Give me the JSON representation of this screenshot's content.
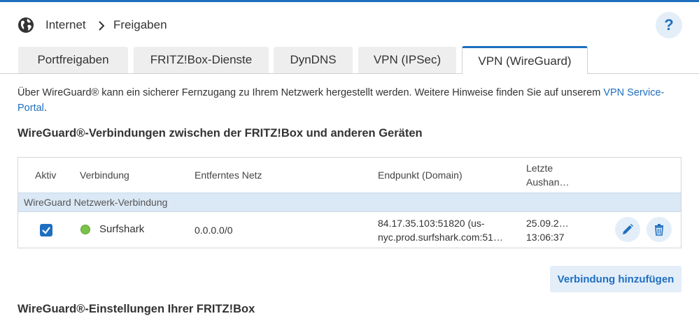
{
  "header": {
    "breadcrumb": [
      "Internet",
      "Freigaben"
    ],
    "help_label": "?"
  },
  "tabs": [
    {
      "label": "Portfreigaben",
      "active": false
    },
    {
      "label": "FRITZ!Box-Dienste",
      "active": false
    },
    {
      "label": "DynDNS",
      "active": false
    },
    {
      "label": "VPN (IPSec)",
      "active": false
    },
    {
      "label": "VPN (WireGuard)",
      "active": true
    }
  ],
  "intro": {
    "text": "Über WireGuard® kann ein sicherer Fernzugang zu Ihrem Netzwerk hergestellt werden. Weitere Hinweise finden Sie auf unserem ",
    "link": "VPN Service-Portal",
    "suffix": "."
  },
  "section_title": "WireGuard®-Verbindungen zwischen der FRITZ!Box und anderen Geräten",
  "table": {
    "headers": {
      "active": "Aktiv",
      "connection": "Verbindung",
      "remote_net": "Entferntes Netz",
      "endpoint": "Endpunkt (Domain)",
      "last_line1": "Letzte",
      "last_line2": "Aushan…"
    },
    "group_label": "WireGuard Netzwerk-Verbindung",
    "rows": [
      {
        "active": true,
        "status_color": "#7bc24a",
        "name": "Surfshark",
        "remote_net": "0.0.0.0/0",
        "endpoint_line1": "84.17.35.103:51820 (us-",
        "endpoint_line2": "nyc.prod.surfshark.com:51…",
        "last_line1": "25.09.2…",
        "last_line2": "13:06:37",
        "icons": [
          "edit-icon",
          "delete-icon"
        ]
      }
    ]
  },
  "add_button": "Verbindung hinzufügen",
  "section_title_2": "WireGuard®-Einstellungen Ihrer FRITZ!Box",
  "colors": {
    "accent": "#1f6fc0",
    "button_bg": "#e3eef9",
    "group_bg": "#dbe8f5",
    "status_green": "#7bc24a"
  }
}
